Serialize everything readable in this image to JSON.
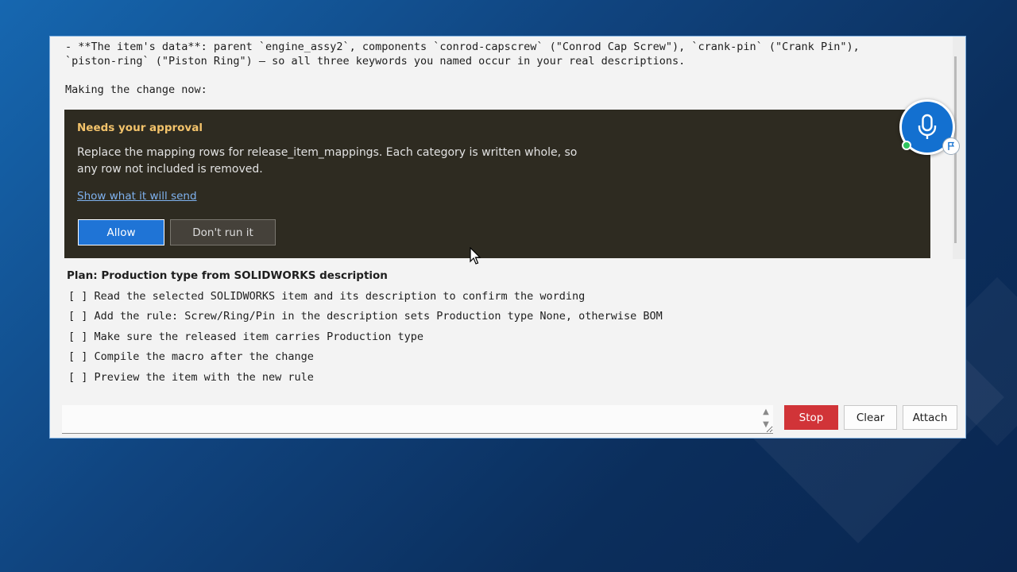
{
  "transcript": {
    "line1": "- **The item's data**: parent `engine_assy2`, components `conrod-capscrew` (\"Conrod Cap Screw\"), `crank-pin` (\"Crank Pin\"),",
    "line2": "`piston-ring` (\"Piston Ring\") — so all three keywords you named occur in your real descriptions.",
    "making_change": "Making the change now:"
  },
  "approval": {
    "title": "Needs your approval",
    "text": "Replace the mapping rows for release_item_mappings. Each category is written whole, so any row not included is removed.",
    "link": "Show what it will send",
    "allow_label": "Allow",
    "dont_label": "Don't run it"
  },
  "plan": {
    "title": "Plan: Production type from SOLIDWORKS description",
    "items": [
      "[ ] Read the selected SOLIDWORKS item and its description to confirm the wording",
      "[ ] Add the rule: Screw/Ring/Pin in the description sets Production type None, otherwise BOM",
      "[ ] Make sure the released item carries Production type",
      "[ ] Compile the macro after the change",
      "[ ] Preview the item with the new rule"
    ]
  },
  "input": {
    "value": ""
  },
  "buttons": {
    "stop": "Stop",
    "clear": "Clear",
    "attach": "Attach"
  },
  "icons": {
    "mic": "microphone-icon",
    "status": "online-dot-icon",
    "flag": "flag-icon"
  },
  "colors": {
    "allow": "#1f74d6",
    "stop": "#d13438",
    "approval_bg": "#2e2b21",
    "approval_title": "#f3c36b",
    "mic": "#1370d0"
  }
}
